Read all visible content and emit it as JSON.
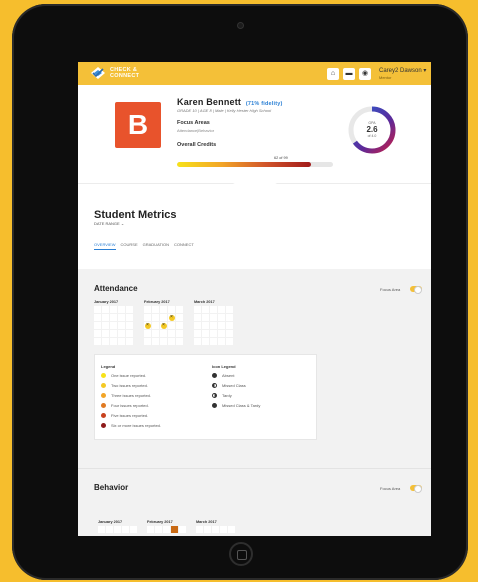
{
  "brand": {
    "line1": "CHECK &",
    "line2": "CONNECT"
  },
  "topbar": {
    "icons": [
      "home-icon",
      "inbox-icon",
      "bell-icon"
    ],
    "user_name": "Carey2 Dawson",
    "user_name_suffix": "▾",
    "user_role": "Mentor"
  },
  "student": {
    "avatar_letter": "B",
    "name": "Karen Bennett",
    "fidelity": "(71% fidelity)",
    "subtitle": "GRADE 10 | AGE 8 | Male | Kelly Hester High School",
    "focus_title": "Focus Areas",
    "focus_sub": "Attendance|Behavior",
    "credits_title": "Overall Credits",
    "credits_text": "62 of 99",
    "credits_progress": 0.86,
    "gpa_label": "GPA",
    "gpa_value": "2.6",
    "gpa_of": "of 4.0",
    "gpa_progress": 0.65
  },
  "metrics": {
    "title": "Student Metrics",
    "date_range": "DATE RANGE",
    "tabs": [
      "OVERVIEW",
      "COURSE",
      "GRADUATION",
      "CONNECT"
    ],
    "active_tab": "OVERVIEW"
  },
  "attendance": {
    "title": "Attendance",
    "focus_label": "Focus Area",
    "months": [
      "January 2017",
      "February 2017",
      "March 2017"
    ],
    "legend_title": "Legend",
    "legend": [
      {
        "label": "One issue reported.",
        "color": "#F7E219"
      },
      {
        "label": "Two issues reported.",
        "color": "#F4C924"
      },
      {
        "label": "Three issues reported.",
        "color": "#F2A527"
      },
      {
        "label": "Four issues reported.",
        "color": "#E07A22"
      },
      {
        "label": "Five issues reported.",
        "color": "#C8421F"
      },
      {
        "label": "Six or more issues reported.",
        "color": "#8E1B1B"
      }
    ],
    "icon_legend_title": "Icon Legend",
    "icon_legend": [
      {
        "label": "Absent",
        "icon": "absent-icon"
      },
      {
        "label": "Missed Class",
        "icon": "missed-class-icon"
      },
      {
        "label": "Tardy",
        "icon": "tardy-icon"
      },
      {
        "label": "Missed Class & Tardy",
        "icon": "missed-class-tardy-icon"
      }
    ]
  },
  "behavior": {
    "title": "Behavior",
    "focus_label": "Focus Area",
    "months": [
      "January 2017",
      "February 2017",
      "March 2017"
    ]
  }
}
